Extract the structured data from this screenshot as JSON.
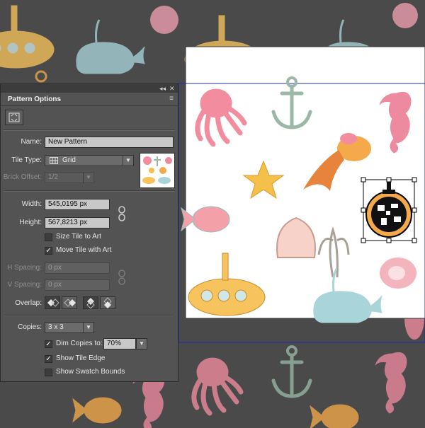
{
  "panel": {
    "collapse_glyph": "◂◂",
    "close_glyph": "✕",
    "title": "Pattern Options",
    "menu_glyph": "≡",
    "name_label": "Name:",
    "name_value": "New Pattern",
    "tile_type_label": "Tile Type:",
    "tile_type_value": "Grid",
    "brick_offset_label": "Brick Offset:",
    "brick_offset_value": "1/2",
    "width_label": "Width:",
    "width_value": "545,0195 px",
    "height_label": "Height:",
    "height_value": "567,8213 px",
    "size_tile_to_art": "Size Tile to Art",
    "size_tile_to_art_checked": false,
    "move_tile_with_art": "Move Tile with Art",
    "move_tile_with_art_checked": true,
    "h_spacing_label": "H Spacing:",
    "h_spacing_value": "0 px",
    "v_spacing_label": "V Spacing:",
    "v_spacing_value": "0 px",
    "overlap_label": "Overlap:",
    "copies_label": "Copies:",
    "copies_value": "3 x 3",
    "dim_copies_label": "Dim Copies to:",
    "dim_copies_checked": true,
    "dim_copies_value": "70%",
    "show_tile_edge": "Show Tile Edge",
    "show_tile_edge_checked": true,
    "show_swatch_bounds": "Show Swatch Bounds",
    "show_swatch_bounds_checked": false
  },
  "colors": {
    "canvas_bg": "#4a4a4a",
    "tile_bg": "#ffffff",
    "tile_edge": "#1f2bb8",
    "octopus": "#f28da0",
    "anchor": "#9ab8a6",
    "fish": "#f4a94a",
    "submarine": "#f7c35c",
    "whale": "#a9d4d9",
    "seahorse": "#ee8aa0"
  }
}
